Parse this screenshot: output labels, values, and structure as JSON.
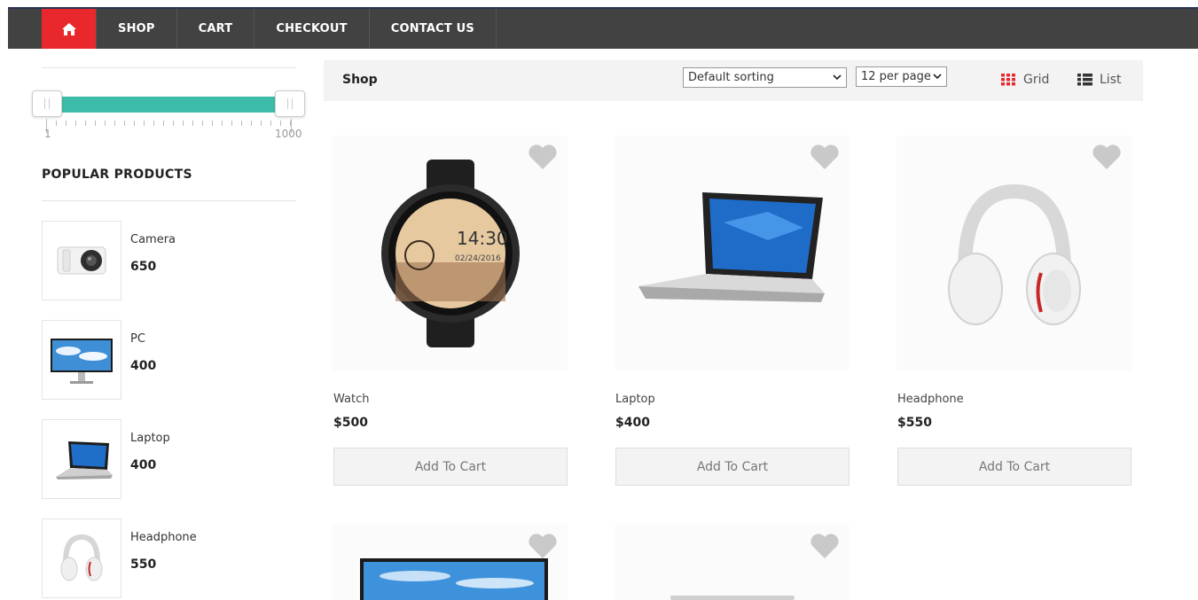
{
  "nav": {
    "items": [
      {
        "label": "SHOP"
      },
      {
        "label": "CART"
      },
      {
        "label": "CHECKOUT"
      },
      {
        "label": "CONTACT US"
      }
    ]
  },
  "price_slider": {
    "min_label": "1",
    "max_label": "1000",
    "low_fraction": 0.0,
    "high_fraction": 1.0
  },
  "sidebar": {
    "popular_title": "POPULAR PRODUCTS",
    "products": [
      {
        "name": "Camera",
        "price": "650"
      },
      {
        "name": "PC",
        "price": "400"
      },
      {
        "name": "Laptop",
        "price": "400"
      },
      {
        "name": "Headphone",
        "price": "550"
      }
    ]
  },
  "toolbar": {
    "title": "Shop",
    "sort_value": "Default sorting",
    "per_page_value": "12 per page",
    "grid_label": "Grid",
    "list_label": "List"
  },
  "products": [
    {
      "name": "Watch",
      "price": "$500",
      "button": "Add To Cart"
    },
    {
      "name": "Laptop",
      "price": "$400",
      "button": "Add To Cart"
    },
    {
      "name": "Headphone",
      "price": "$550",
      "button": "Add To Cart"
    }
  ],
  "colors": {
    "accent_red": "#e8282c",
    "slider_teal": "#3dbda9",
    "nav_bg": "#424242"
  }
}
